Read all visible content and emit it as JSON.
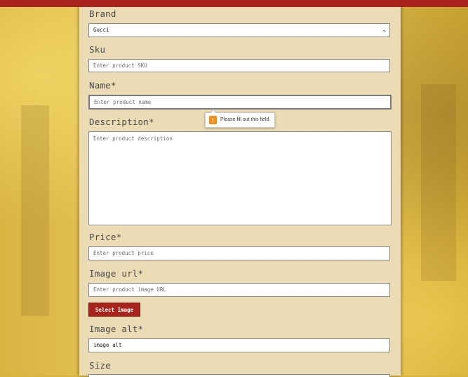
{
  "colors": {
    "accent": "#a8231c",
    "panel": "#ecdcb5",
    "warning": "#ef8d22"
  },
  "form": {
    "brand": {
      "label": "Brand",
      "value": "Gucci"
    },
    "sku": {
      "label": "Sku",
      "placeholder": "Enter product SKU"
    },
    "name": {
      "label": "Name*",
      "placeholder": "Enter product name"
    },
    "description": {
      "label": "Description*",
      "placeholder": "Enter product description"
    },
    "price": {
      "label": "Price*",
      "placeholder": "Enter product price"
    },
    "image_url": {
      "label": "Image url*",
      "placeholder": "Enter product image URL"
    },
    "select_image_label": "Select Image",
    "image_alt": {
      "label": "Image alt*",
      "value": "image alt"
    },
    "size": {
      "label": "Size"
    }
  },
  "validation": {
    "message": "Please fill out this field.",
    "icon": "warning-icon"
  }
}
